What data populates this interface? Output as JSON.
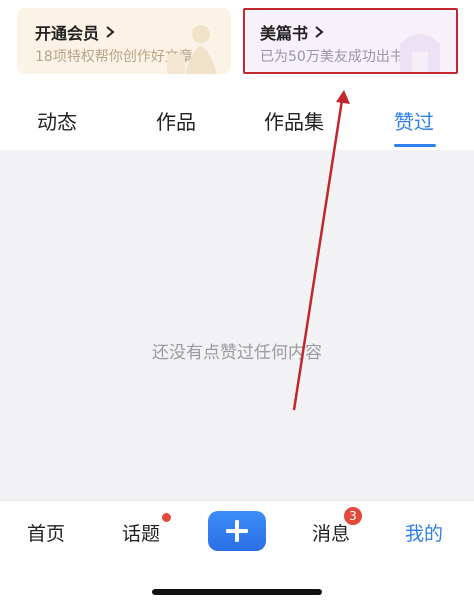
{
  "promo": {
    "vip_title": "开通会员",
    "vip_subtitle": "18项特权帮你创作好文章",
    "book_title": "美篇书",
    "book_subtitle": "已为50万美友成功出书"
  },
  "tabs": {
    "dynamic": "动态",
    "works": "作品",
    "collections": "作品集",
    "liked": "赞过"
  },
  "empty_message": "还没有点赞过任何内容",
  "bottom_nav": {
    "home": "首页",
    "topics": "话题",
    "messages": "消息",
    "messages_badge": "3",
    "mine": "我的"
  },
  "colors": {
    "accent": "#2f7ff0",
    "annotation": "#c1272d",
    "badge": "#e24b3b"
  }
}
